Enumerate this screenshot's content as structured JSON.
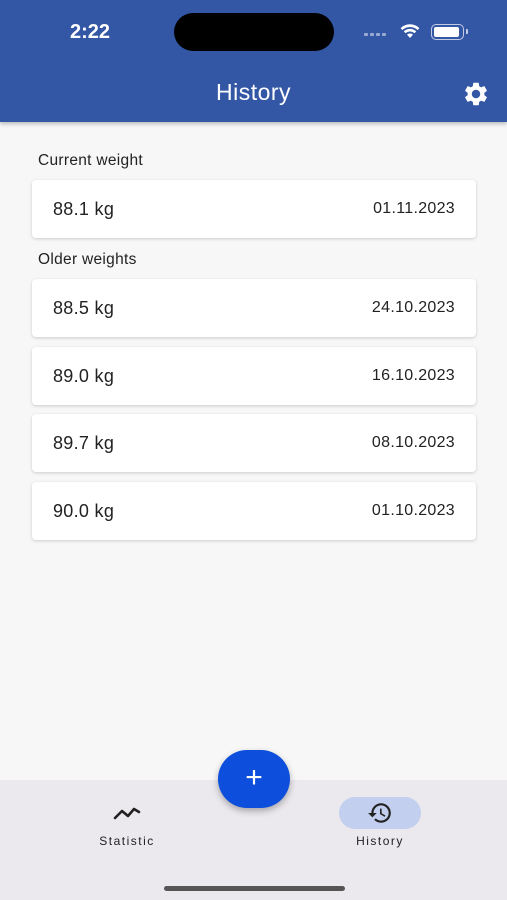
{
  "status_bar": {
    "time": "2:22"
  },
  "header": {
    "title": "History",
    "settings_icon": "gear-icon"
  },
  "current": {
    "label": "Current weight",
    "entry": {
      "weight": "88.1 kg",
      "date": "01.11.2023"
    }
  },
  "older": {
    "label": "Older weights",
    "entries": [
      {
        "weight": "88.5 kg",
        "date": "24.10.2023"
      },
      {
        "weight": "89.0 kg",
        "date": "16.10.2023"
      },
      {
        "weight": "89.7 kg",
        "date": "08.10.2023"
      },
      {
        "weight": "90.0 kg",
        "date": "01.10.2023"
      }
    ]
  },
  "fab": {
    "label": "+",
    "icon": "plus-icon"
  },
  "bottom_nav": {
    "items": [
      {
        "label": "Statistic",
        "icon": "chart-line-icon",
        "active": false
      },
      {
        "label": "History",
        "icon": "history-icon",
        "active": true
      }
    ]
  },
  "colors": {
    "header": "#3457a5",
    "fab": "#0d4fdc",
    "active_nav": "#c3cfee"
  }
}
